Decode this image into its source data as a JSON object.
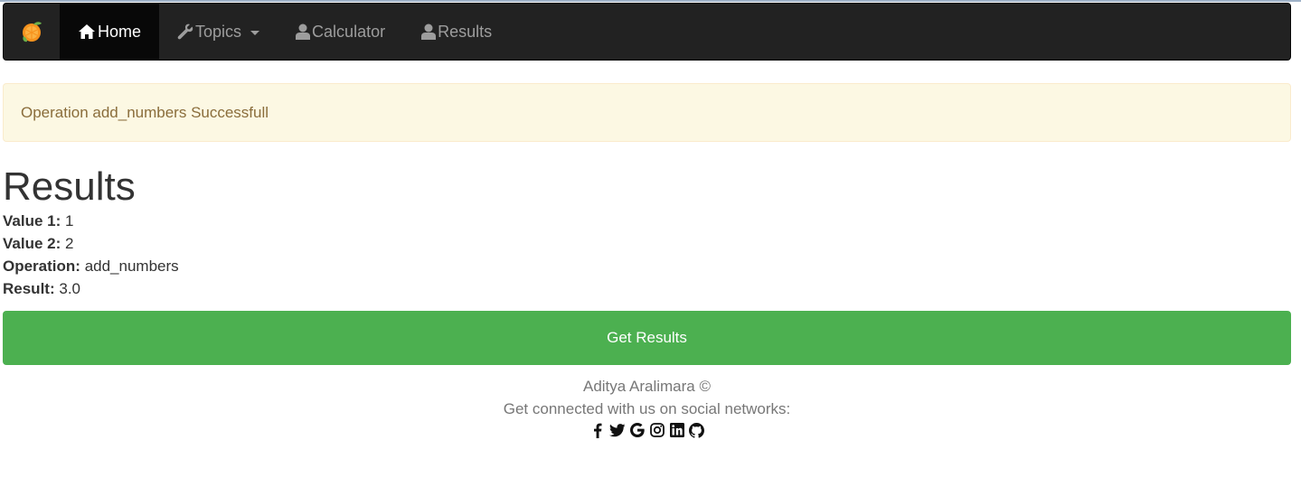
{
  "navbar": {
    "brand_icon": "orange-logo-icon",
    "items": [
      {
        "label": "Home",
        "icon": "home-icon",
        "active": true
      },
      {
        "label": "Topics",
        "icon": "wrench-icon",
        "dropdown": true
      },
      {
        "label": "Calculator",
        "icon": "user-icon"
      },
      {
        "label": "Results",
        "icon": "user-icon"
      }
    ]
  },
  "alert": {
    "text": "Operation add_numbers Successfull"
  },
  "main": {
    "title": "Results",
    "fields": [
      {
        "label": "Value 1:",
        "value": "1"
      },
      {
        "label": "Value 2:",
        "value": "2"
      },
      {
        "label": "Operation:",
        "value": "add_numbers"
      },
      {
        "label": "Result:",
        "value": "3.0"
      }
    ],
    "button_label": "Get Results"
  },
  "footer": {
    "author": "Aditya Aralimara ©",
    "tagline": "Get connected with us on social networks:",
    "social_icons": [
      "facebook-icon",
      "twitter-icon",
      "google-icon",
      "instagram-icon",
      "linkedin-icon",
      "github-icon"
    ]
  },
  "colors": {
    "navbar_bg": "#222222",
    "active_bg": "#080808",
    "alert_bg": "#fcf8e3",
    "alert_text": "#8a6d3b",
    "button_bg": "#4cb050"
  }
}
